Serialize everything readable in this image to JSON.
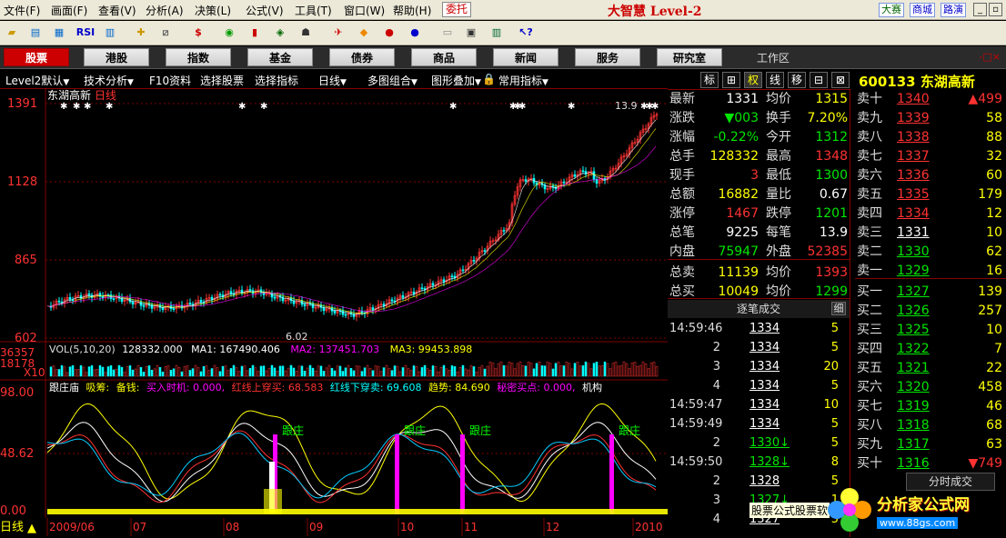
{
  "menu": [
    "文件(F)",
    "画面(F)",
    "查看(V)",
    "分析(A)",
    "决策(L)",
    "公式(V)",
    "工具(T)",
    "窗口(W)",
    "帮助(H)"
  ],
  "delegate": "委托",
  "brand": "大智慧 Level-2",
  "right_buttons": [
    "大赛",
    "商城",
    "路演"
  ],
  "toolbar_text": {
    "rsi": "RSI",
    "s": "$"
  },
  "nav": [
    "股票",
    "港股",
    "指数",
    "基金",
    "债券",
    "商品",
    "新闻",
    "服务",
    "研究室"
  ],
  "workarea": "工作区",
  "workclose": "-□×",
  "tabs": [
    "Level2默认",
    "技术分析",
    "F10资料",
    "选择股票",
    "选择指标",
    "日线",
    "多图组合",
    "图形叠加",
    "常用指标"
  ],
  "chart": {
    "stock_label": "东湖高新",
    "period": "日线",
    "price_ticks": [
      "1391",
      "1128",
      "865",
      "602"
    ],
    "hi_label": "13.9",
    "lo_label": "6.02",
    "vol_ticks": [
      "36357",
      "18178",
      "X10"
    ],
    "osc_ticks": [
      "98.00",
      "48.62",
      "0.00"
    ],
    "vol_header": {
      "name": "VOL(5,10,20)",
      "v": "128332.000",
      "ma1": "MA1: 167490.406",
      "ma2": "MA2: 137451.703",
      "ma3": "MA3: 99453.898"
    },
    "osc_header": {
      "t1": "跟庄庙",
      "t2": "吸筹:",
      "t3": "备钱:",
      "t4": "买入时机: 0.000,",
      "t5": "红线上穿买: 68.583",
      "t6": "红线下穿卖: 69.608",
      "t7": "趋势: 84.690",
      "t8": "秘密买点: 0.000,",
      "t9": "机构"
    },
    "follow_label": "跟庄",
    "period_mode": "日线",
    "dates": [
      "2009/06",
      "07",
      "08",
      "09",
      "10",
      "11",
      "12",
      "2010"
    ]
  },
  "quote": {
    "tabs": [
      "标",
      "⊞",
      "权",
      "线",
      "移"
    ],
    "code": "600133",
    "name": "东湖高新",
    "rows": [
      {
        "l": "最新",
        "v": "1331",
        "l2": "均价",
        "v2": "1315"
      },
      {
        "l": "涨跌",
        "v": "▼003",
        "l2": "换手",
        "v2": "7.20%"
      },
      {
        "l": "涨幅",
        "v": "-0.22%",
        "l2": "今开",
        "v2": "1312"
      },
      {
        "l": "总手",
        "v": "128332",
        "l2": "最高",
        "v2": "1348"
      },
      {
        "l": "现手",
        "v": "3",
        "l2": "最低",
        "v2": "1300"
      },
      {
        "l": "总额",
        "v": "16882",
        "l2": "量比",
        "v2": "0.67"
      },
      {
        "l": "涨停",
        "v": "1467",
        "l2": "跌停",
        "v2": "1201"
      },
      {
        "l": "总笔",
        "v": "9225",
        "l2": "每笔",
        "v2": "13.9"
      },
      {
        "l": "内盘",
        "v": "75947",
        "l2": "外盘",
        "v2": "52385"
      },
      {
        "l": "总卖",
        "v": "11139",
        "l2": "均价",
        "v2": "1393"
      },
      {
        "l": "总买",
        "v": "10049",
        "l2": "均价",
        "v2": "1299"
      }
    ],
    "asks": [
      {
        "l": "卖十",
        "p": "1340",
        "v": "▲499"
      },
      {
        "l": "卖九",
        "p": "1339",
        "v": "58"
      },
      {
        "l": "卖八",
        "p": "1338",
        "v": "88"
      },
      {
        "l": "卖七",
        "p": "1337",
        "v": "32"
      },
      {
        "l": "卖六",
        "p": "1336",
        "v": "60"
      },
      {
        "l": "卖五",
        "p": "1335",
        "v": "179"
      },
      {
        "l": "卖四",
        "p": "1334",
        "v": "12"
      },
      {
        "l": "卖三",
        "p": "1331",
        "v": "10"
      },
      {
        "l": "卖二",
        "p": "1330",
        "v": "62"
      },
      {
        "l": "卖一",
        "p": "1329",
        "v": "16"
      }
    ],
    "bids": [
      {
        "l": "买一",
        "p": "1327",
        "v": "139"
      },
      {
        "l": "买二",
        "p": "1326",
        "v": "257"
      },
      {
        "l": "买三",
        "p": "1325",
        "v": "10"
      },
      {
        "l": "买四",
        "p": "1322",
        "v": "7"
      },
      {
        "l": "买五",
        "p": "1321",
        "v": "22"
      },
      {
        "l": "买六",
        "p": "1320",
        "v": "458"
      },
      {
        "l": "买七",
        "p": "1319",
        "v": "46"
      },
      {
        "l": "买八",
        "p": "1318",
        "v": "68"
      },
      {
        "l": "买九",
        "p": "1317",
        "v": "63"
      },
      {
        "l": "买十",
        "p": "1316",
        "v": "▼749"
      }
    ],
    "trade_header": "逐笔成交",
    "trade_btn": "细",
    "trades": [
      {
        "t": "14:59:46",
        "p": "1334",
        "v": "5"
      },
      {
        "t": "2",
        "p": "1334",
        "v": "5"
      },
      {
        "t": "3",
        "p": "1334",
        "v": "20"
      },
      {
        "t": "4",
        "p": "1334",
        "v": "5"
      },
      {
        "t": "14:59:47",
        "p": "1334",
        "v": "10"
      },
      {
        "t": "14:59:49",
        "p": "1334",
        "v": "5"
      },
      {
        "t": "2",
        "p": "1330↓",
        "v": "5"
      },
      {
        "t": "14:59:50",
        "p": "1328↓",
        "v": "8"
      },
      {
        "t": "2",
        "p": "1328",
        "v": "5"
      },
      {
        "t": "3",
        "p": "1327↓",
        "v": "1"
      },
      {
        "t": "4",
        "p": "1327",
        "v": "5"
      }
    ],
    "fs_btn": "分时成交"
  },
  "status": "股票公式股票软",
  "logo": {
    "t1": "分析家公式网",
    "t2": "www.88gs.com"
  },
  "colors": {
    "up": "#ff3232",
    "down": "#00ffff",
    "ma5": "#ffffff",
    "ma10": "#ffff00",
    "ma20": "#ff00ff",
    "grid": "#800000"
  }
}
